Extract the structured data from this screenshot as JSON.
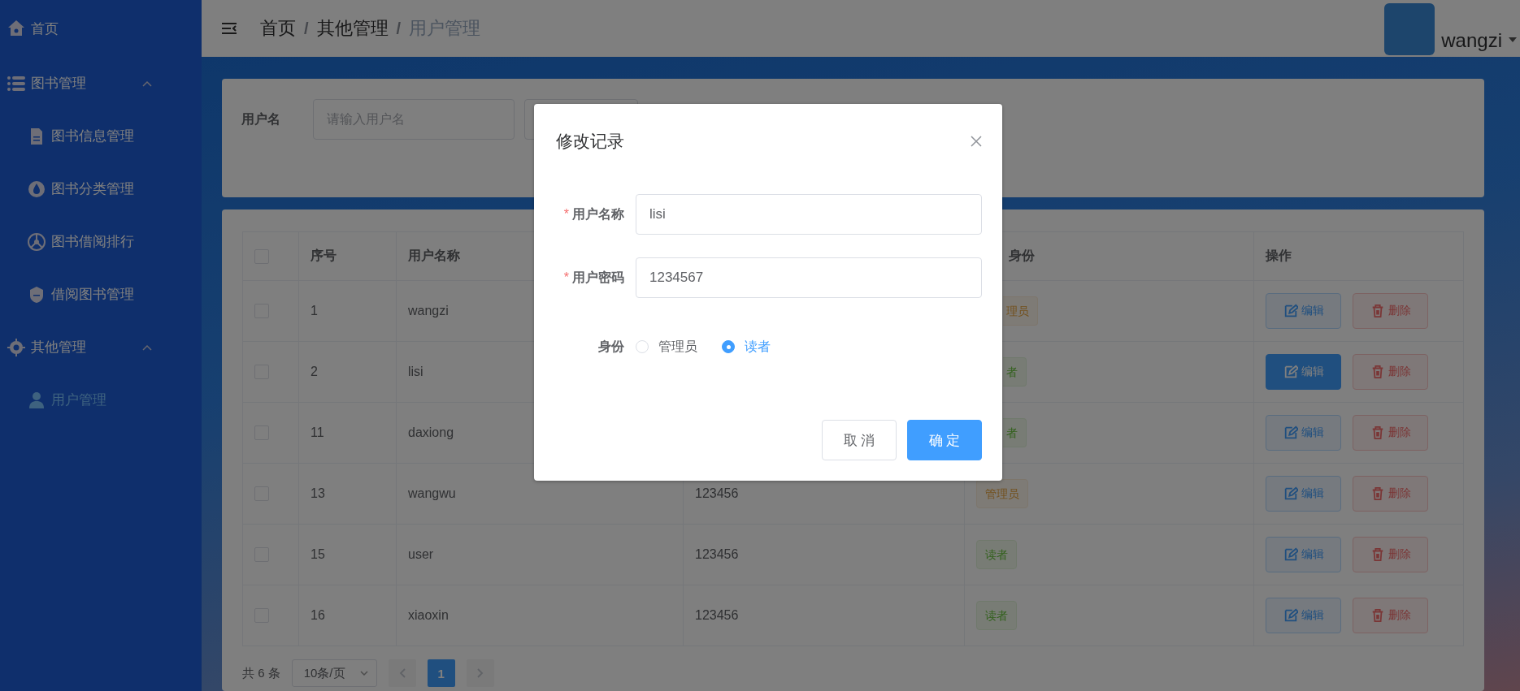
{
  "sidebar": {
    "items": [
      {
        "label": "首页",
        "kind": "link",
        "selected": false
      },
      {
        "label": "图书管理",
        "kind": "group",
        "expanded": true,
        "children": [
          {
            "label": "图书信息管理",
            "selected": false
          },
          {
            "label": "图书分类管理",
            "selected": false
          },
          {
            "label": "图书借阅排行",
            "selected": false
          },
          {
            "label": "借阅图书管理",
            "selected": false
          }
        ]
      },
      {
        "label": "其他管理",
        "kind": "group",
        "expanded": true,
        "children": [
          {
            "label": "用户管理",
            "selected": true
          }
        ]
      }
    ]
  },
  "header": {
    "breadcrumbs": [
      "首页",
      "其他管理",
      "用户管理"
    ],
    "separator": "/",
    "username": "wangzi"
  },
  "search": {
    "label": "用户名",
    "placeholder": "请输入用户名"
  },
  "table": {
    "header": {
      "checked": false,
      "index": "序号",
      "name": "用户名称",
      "role": {
        "text": "身份",
        "cut": true
      },
      "actions": "操作"
    },
    "rows": [
      {
        "checked": false,
        "index": "1",
        "name": "wangzi",
        "role": {
          "text": "理员",
          "kind": "admin",
          "cut": true
        },
        "edit": "编辑",
        "delete": "删除",
        "edit_active": false
      },
      {
        "checked": false,
        "index": "2",
        "name": "lisi",
        "role": {
          "text": "者",
          "kind": "reader",
          "cut": true
        },
        "edit": "编辑",
        "delete": "删除",
        "edit_active": true
      },
      {
        "checked": false,
        "index": "11",
        "name": "daxiong",
        "role": {
          "text": "者",
          "kind": "reader",
          "cut": true
        },
        "edit": "编辑",
        "delete": "删除",
        "edit_active": false
      },
      {
        "checked": false,
        "index": "13",
        "name": "wangwu",
        "password": "123456",
        "role": {
          "text": "管理员",
          "kind": "admin",
          "cut": false
        },
        "edit": "编辑",
        "delete": "删除",
        "edit_active": false
      },
      {
        "checked": false,
        "index": "15",
        "name": "user",
        "password": "123456",
        "role": {
          "text": "读者",
          "kind": "reader",
          "cut": false
        },
        "edit": "编辑",
        "delete": "删除",
        "edit_active": false
      },
      {
        "checked": false,
        "index": "16",
        "name": "xiaoxin",
        "password": "123456",
        "role": {
          "text": "读者",
          "kind": "reader",
          "cut": false
        },
        "edit": "编辑",
        "delete": "删除",
        "edit_active": false
      }
    ]
  },
  "pagination": {
    "total": "共 6 条",
    "page_size": "10条/页",
    "pages": [
      {
        "label": "1",
        "selected": true
      }
    ]
  },
  "dialog": {
    "title": "修改记录",
    "fields": [
      {
        "marker": "*",
        "label": "用户名称",
        "value": "lisi"
      },
      {
        "marker": "*",
        "label": "用户密码",
        "value": "1234567"
      }
    ],
    "role": {
      "label": "身份",
      "options": [
        {
          "label": "管理员",
          "selected": false
        },
        {
          "label": "读者",
          "selected": true
        }
      ]
    },
    "buttons": [
      {
        "label": "取 消",
        "kind": "cancel"
      },
      {
        "label": "确 定",
        "kind": "primary"
      }
    ]
  }
}
